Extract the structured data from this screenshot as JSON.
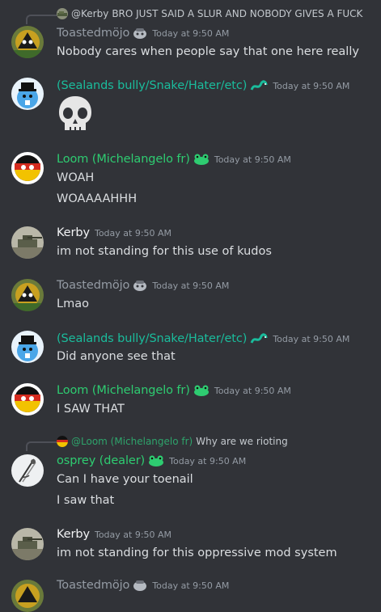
{
  "messages": [
    {
      "reply": {
        "author": "@Kerby",
        "text": "BRO JUST SAID A SLUR AND NOBODY GIVES A FUCK"
      },
      "author": "Toastedmöjo",
      "timestamp": "Today at 9:50 AM",
      "lines": [
        "Nobody cares when people say that one here really"
      ]
    },
    {
      "author": "(Sealands bully/Snake/Hater/etc)",
      "timestamp": "Today at 9:50 AM",
      "emoji": "skull"
    },
    {
      "author": "Loom (Michelangelo fr)",
      "timestamp": "Today at 9:50 AM",
      "lines": [
        "WOAH",
        "WOAAAAHHH"
      ]
    },
    {
      "author": "Kerby",
      "timestamp": "Today at 9:50 AM",
      "lines": [
        "im not standing for this use of kudos"
      ]
    },
    {
      "author": "Toastedmöjo",
      "timestamp": "Today at 9:50 AM",
      "lines": [
        "Lmao"
      ]
    },
    {
      "author": "(Sealands bully/Snake/Hater/etc)",
      "timestamp": "Today at 9:50 AM",
      "lines": [
        "Did anyone see that"
      ]
    },
    {
      "author": "Loom (Michelangelo fr)",
      "timestamp": "Today at 9:50 AM",
      "lines": [
        "I SAW THAT"
      ]
    },
    {
      "reply": {
        "author": "@Loom (Michelangelo fr)",
        "text": "Why are we rioting"
      },
      "author": "osprey (dealer)",
      "timestamp": "Today at 9:50 AM",
      "lines": [
        "Can I have your toenail",
        "I saw that"
      ]
    },
    {
      "author": "Kerby",
      "timestamp": "Today at 9:50 AM",
      "lines": [
        "im not standing for this oppressive mod system"
      ]
    },
    {
      "author": "Toastedmöjo",
      "timestamp": "Today at 9:50 AM"
    }
  ],
  "colors": {
    "background": "#313338",
    "gray_name": "#949ba4",
    "teal_name": "#1abc9c",
    "green_name": "#2ecc71",
    "white_name": "#f2f3f5"
  }
}
